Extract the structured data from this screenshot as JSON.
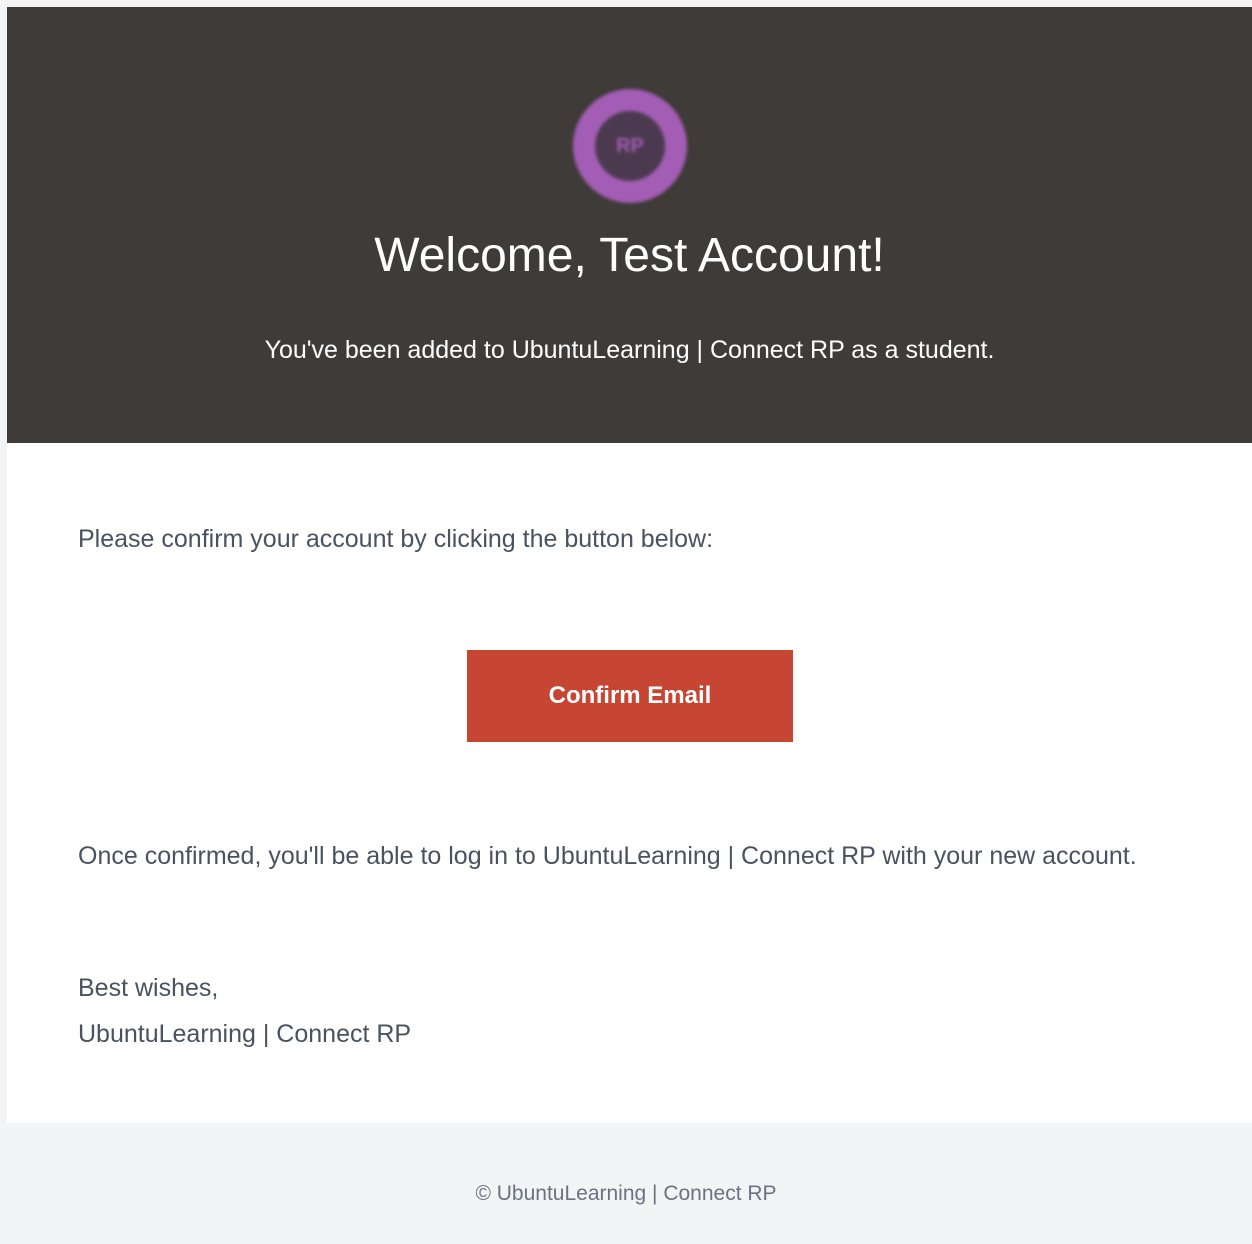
{
  "colors": {
    "hero_background": "#3f3b38",
    "logo_accent": "#a35db4",
    "button_background": "#c64533",
    "body_text": "#4a5260",
    "page_background": "#f3f4f6"
  },
  "header": {
    "logo": {
      "icon": "rp-logo-icon",
      "text": "RP"
    },
    "title": "Welcome, Test Account!",
    "subtitle": "You've been added to UbuntuLearning | Connect RP as a student."
  },
  "body": {
    "instruction": "Please confirm your account by clicking the button below:",
    "confirm_button_label": "Confirm Email",
    "info": "Once confirmed, you'll be able to log in to UbuntuLearning | Connect RP with your new account.",
    "signoff_greeting": "Best wishes,",
    "signoff_name": "UbuntuLearning | Connect RP"
  },
  "footer": {
    "copyright": "© UbuntuLearning | Connect RP"
  }
}
